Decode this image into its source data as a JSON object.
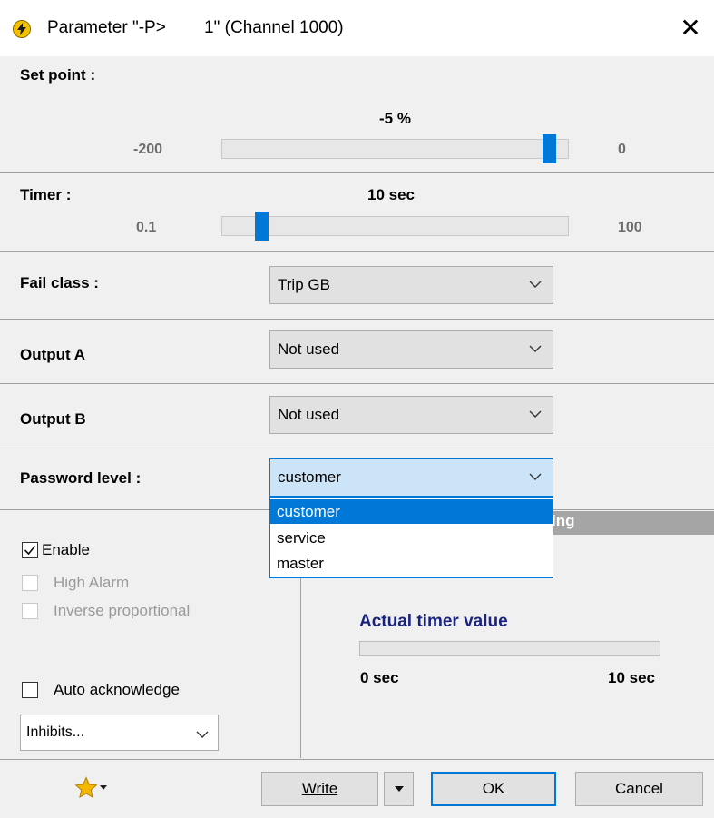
{
  "window": {
    "title": "Parameter \"-P>        1\" (Channel 1000)",
    "close_glyph": "✕"
  },
  "setpoint": {
    "label": "Set point :",
    "value": "-5 %",
    "min": "-200",
    "max": "0",
    "fraction": 0.975
  },
  "timer": {
    "label": "Timer :",
    "value": "10 sec",
    "min": "0.1",
    "max": "100",
    "fraction": 0.1
  },
  "fail_class": {
    "label": "Fail class :",
    "selected": "Trip GB"
  },
  "output_a": {
    "label": "Output A",
    "selected": "Not used"
  },
  "output_b": {
    "label": "Output B",
    "selected": "Not used"
  },
  "password_level": {
    "label": "Password level :",
    "selected": "customer",
    "options": [
      "customer",
      "service",
      "master"
    ]
  },
  "checkboxes": {
    "enable": {
      "label": "Enable",
      "checked": true
    },
    "high_alarm": {
      "label": "High Alarm",
      "checked": false,
      "disabled": true
    },
    "inverse": {
      "label": "Inverse proportional",
      "checked": false,
      "disabled": true
    },
    "auto_ack": {
      "label": "Auto acknowledge",
      "checked": false
    }
  },
  "inhibits": {
    "selected": "Inhibits..."
  },
  "status_band": {
    "text": "ing"
  },
  "actual_timer": {
    "heading": "Actual timer value",
    "min": "0 sec",
    "max": "10 sec",
    "fraction": 0
  },
  "footer": {
    "favorites_icon": "star-icon",
    "write_label": "Write",
    "ok_label": "OK",
    "cancel_label": "Cancel"
  },
  "colors": {
    "accent": "#0078d7",
    "star": "#f5b800",
    "heading": "#1a237e"
  }
}
